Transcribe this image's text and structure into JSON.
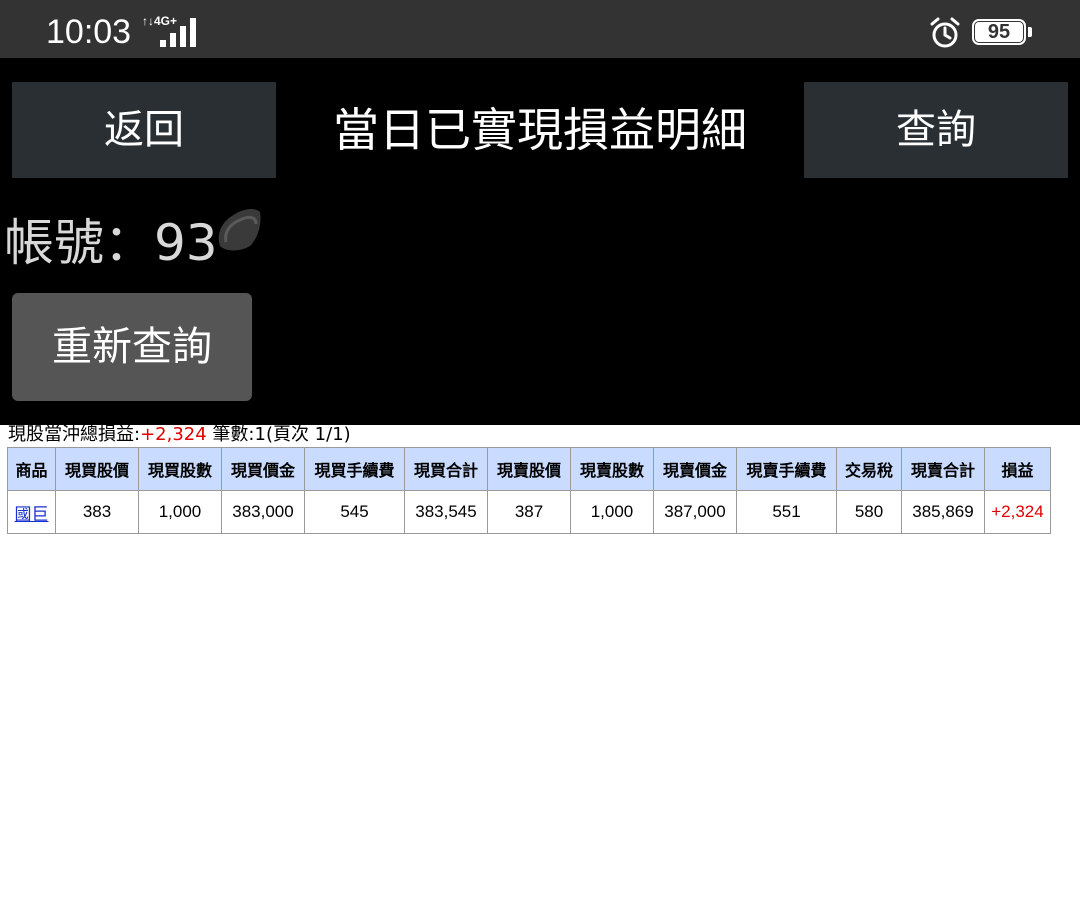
{
  "status_bar": {
    "time": "10:03",
    "network": "4G+",
    "battery": "95",
    "icons": [
      "signal-icon",
      "alarm-icon",
      "battery-icon"
    ]
  },
  "header": {
    "back_label": "返回",
    "title": "當日已實現損益明細",
    "query_label": "查詢"
  },
  "account": {
    "label": "帳號：93"
  },
  "requery_label": "重新查詢",
  "summary": {
    "prefix": "現股當沖總損益:",
    "total": "+2,324",
    "suffix": " 筆數:1(頁次 1/1)"
  },
  "table": {
    "headers": [
      "商品",
      "現買股價",
      "現買股數",
      "現買價金",
      "現買手續費",
      "現買合計",
      "現賣股價",
      "現賣股數",
      "現賣價金",
      "現賣手續費",
      "交易稅",
      "現賣合計",
      "損益"
    ],
    "rows": [
      [
        "國巨",
        "383",
        "1,000",
        "383,000",
        "545",
        "383,545",
        "387",
        "1,000",
        "387,000",
        "551",
        "580",
        "385,869",
        "+2,324"
      ]
    ]
  },
  "colors": {
    "status_bar_bg": "#333333",
    "header_bg": "#000000",
    "button_bg": "#2a2f33",
    "requery_bg": "#555555",
    "table_header_bg": "#c9dcff",
    "profit_red": "#e00000",
    "link_blue": "#1a2fd0"
  }
}
